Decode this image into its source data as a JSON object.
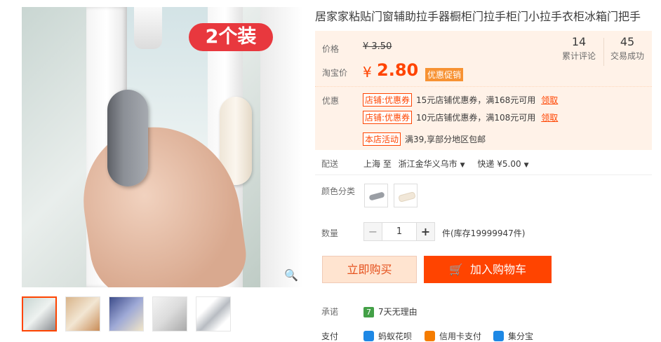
{
  "product": {
    "title": "居家家粘贴门窗辅助拉手器橱柜门拉手柜门小拉手衣柜冰箱门把手",
    "badge": "2个装"
  },
  "price": {
    "label_price": "价格",
    "original": "¥ 3.50",
    "label_taobao": "淘宝价",
    "symbol": "¥",
    "current": "2.80",
    "promo_tag": "优惠促销"
  },
  "stats": [
    {
      "value": "14",
      "label": "累计评论"
    },
    {
      "value": "45",
      "label": "交易成功"
    }
  ],
  "promotions": {
    "label": "优惠",
    "coupons": [
      {
        "tag": "店铺:优惠券",
        "text": "15元店铺优惠券，满168元可用",
        "action": "领取"
      },
      {
        "tag": "店铺:优惠券",
        "text": "10元店铺优惠券，满108元可用",
        "action": "领取"
      }
    ],
    "activity": {
      "tag": "本店活动",
      "text": "满39,享部分地区包邮"
    }
  },
  "delivery": {
    "label": "配送",
    "from": "上海 至",
    "to": "浙江金华义乌市",
    "method": "快递 ¥5.00"
  },
  "colors": {
    "label": "颜色分类",
    "options": [
      {
        "name": "gray",
        "color": "#9a9ea4"
      },
      {
        "name": "beige",
        "color": "#f1e7d8"
      }
    ]
  },
  "quantity": {
    "label": "数量",
    "minus": "−",
    "value": "1",
    "plus": "+",
    "stock": "件(库存19999947件)"
  },
  "actions": {
    "buy_now": "立即购买",
    "add_cart": "加入购物车"
  },
  "pledge": {
    "label": "承诺",
    "icon_text": "7",
    "text": "7天无理由"
  },
  "payment": {
    "label": "支付",
    "methods": [
      {
        "name": "蚂蚁花呗",
        "color": "#1e88e5"
      },
      {
        "name": "信用卡支付",
        "color": "#f57c00"
      },
      {
        "name": "集分宝",
        "color": "#1e88e5"
      }
    ]
  },
  "icons": {
    "zoom": "magnifier-icon",
    "cart": "cart-icon"
  }
}
